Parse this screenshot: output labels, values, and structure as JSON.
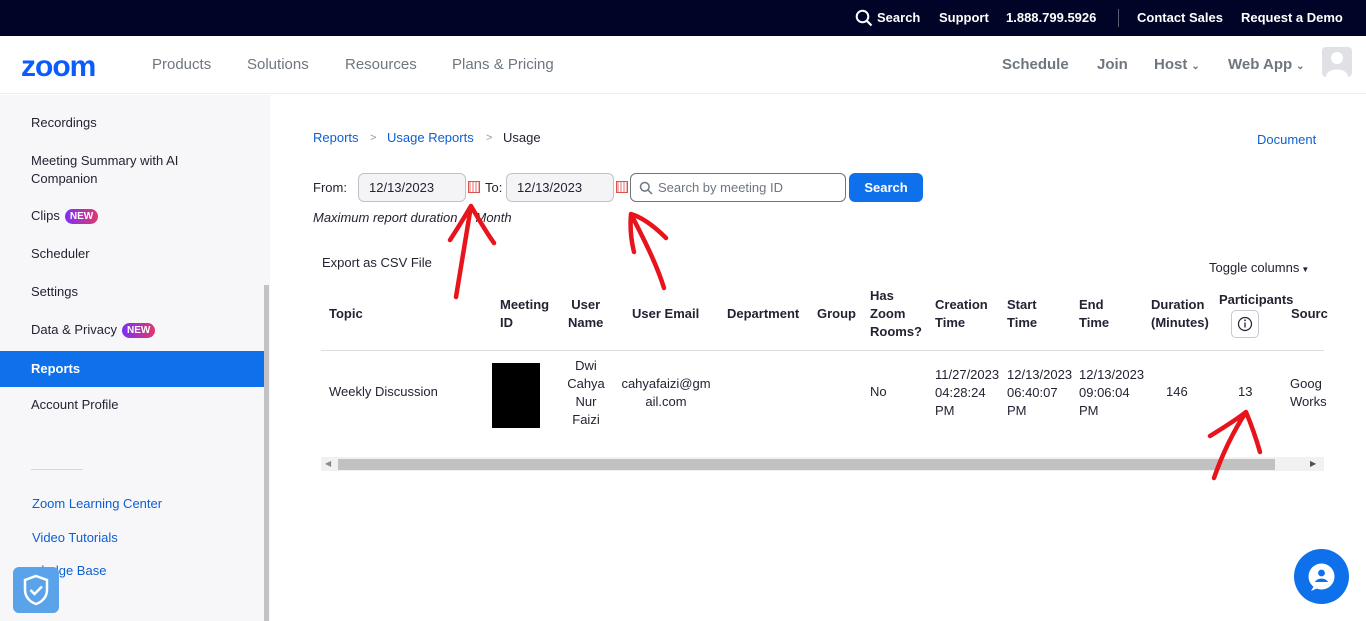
{
  "topbar": {
    "search_label": "Search",
    "support_label": "Support",
    "phone": "1.888.799.5926",
    "contact_sales_label": "Contact Sales",
    "request_demo_label": "Request a Demo"
  },
  "navbar": {
    "logo": "zoom",
    "links": [
      "Products",
      "Solutions",
      "Resources",
      "Plans & Pricing"
    ],
    "schedule_label": "Schedule",
    "join_label": "Join",
    "host_label": "Host",
    "webapp_label": "Web App"
  },
  "sidebar": {
    "items": [
      {
        "label": "Recordings"
      },
      {
        "label": "Meeting Summary with AI Companion"
      },
      {
        "label": "Clips",
        "badge": "NEW"
      },
      {
        "label": "Scheduler"
      },
      {
        "label": "Settings"
      },
      {
        "label": "Data & Privacy",
        "badge": "NEW"
      },
      {
        "label": "Reports",
        "active": true
      },
      {
        "label": "Account Profile"
      }
    ],
    "links": [
      "Zoom Learning Center",
      "Video Tutorials",
      "wledge Base"
    ]
  },
  "breadcrumb": {
    "items": [
      "Reports",
      "Usage Reports",
      "Usage"
    ],
    "document_label": "Document"
  },
  "filter": {
    "from_label": "From:",
    "from_value": "12/13/2023",
    "to_label": "To:",
    "to_value": "12/13/2023",
    "search_placeholder": "Search by meeting ID",
    "search_button": "Search",
    "note_part1": "Maximum report duration",
    "note_part2": "Month"
  },
  "table_tools": {
    "export_label": "Export as CSV File",
    "toggle_label": "Toggle columns"
  },
  "table": {
    "headers": {
      "topic": "Topic",
      "meeting_id": [
        "Meeting",
        "ID"
      ],
      "user_name": [
        "User",
        "Name"
      ],
      "user_email": "User Email",
      "department": "Department",
      "group": "Group",
      "has_zoom_rooms": [
        "Has",
        "Zoom",
        "Rooms?"
      ],
      "creation_time": [
        "Creation",
        "Time"
      ],
      "start_time": [
        "Start",
        "Time"
      ],
      "end_time": [
        "End",
        "Time"
      ],
      "duration": [
        "Duration",
        "(Minutes)"
      ],
      "participants": "Participants",
      "source": "Sourc"
    },
    "row": {
      "topic": "Weekly Discussion",
      "user_name": [
        "Dwi",
        "Cahya",
        "Nur",
        "Faizi"
      ],
      "user_email": [
        "cahyafaizi@gm",
        "ail.com"
      ],
      "has_zoom_rooms": "No",
      "creation_time": [
        "11/27/2023",
        "04:28:24",
        "PM"
      ],
      "start_time": [
        "12/13/2023",
        "06:40:07",
        "PM"
      ],
      "end_time": [
        "12/13/2023",
        "09:06:04",
        "PM"
      ],
      "duration": "146",
      "participants": "13",
      "source": [
        "Goog",
        "Works"
      ]
    }
  },
  "colors": {
    "topbar_bg": "#000426",
    "brand_blue": "#0b5cff",
    "accent": "#0e71eb",
    "link": "#0e5fd1",
    "annotation_red": "#e8141c"
  }
}
